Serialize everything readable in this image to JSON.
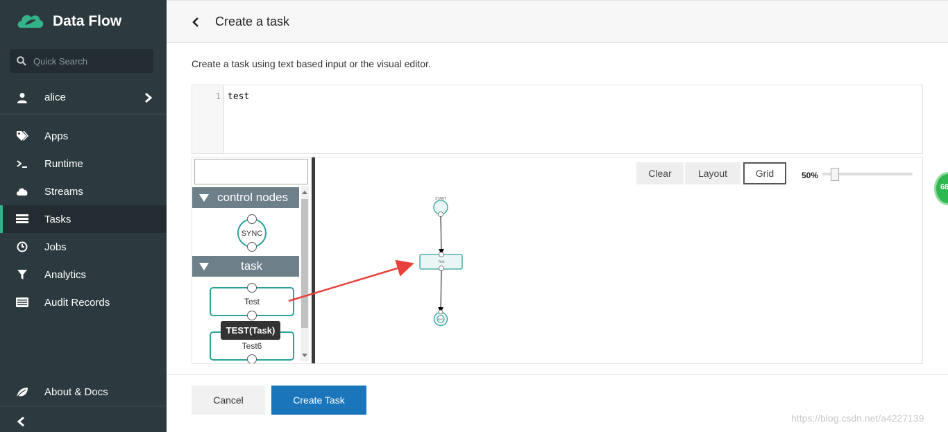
{
  "sidebar": {
    "brand": "Data Flow",
    "search_placeholder": "Quick Search",
    "user": "alice",
    "items": [
      {
        "label": "Apps",
        "icon": "tags-icon"
      },
      {
        "label": "Runtime",
        "icon": "terminal-icon"
      },
      {
        "label": "Streams",
        "icon": "cloud-icon"
      },
      {
        "label": "Tasks",
        "icon": "tasks-icon",
        "active": true
      },
      {
        "label": "Jobs",
        "icon": "clock-icon"
      },
      {
        "label": "Analytics",
        "icon": "filter-icon"
      },
      {
        "label": "Audit Records",
        "icon": "list-icon"
      }
    ],
    "about": "About & Docs"
  },
  "header": {
    "title": "Create a task"
  },
  "subtitle": "Create a task using text based input or the visual editor.",
  "editor": {
    "line_number": "1",
    "code": "test"
  },
  "palette": {
    "groups": [
      "control nodes",
      "task"
    ],
    "sync_label": "SYNC",
    "task_items": [
      "Test",
      "Test6"
    ],
    "tooltip": "TEST(Task)"
  },
  "canvas": {
    "tools": [
      "Clear",
      "Layout",
      "Grid"
    ],
    "zoom": "50%",
    "start_label": "START",
    "task_label": "Test",
    "end_label": "END"
  },
  "actions": {
    "cancel": "Cancel",
    "create": "Create Task"
  },
  "badge": "68",
  "watermark": "https://blog.csdn.net/a4227139",
  "colors": {
    "sidebar": "#2c3a3f",
    "accent": "#34b38a",
    "primary": "#1b75ba",
    "node": "#2aa198",
    "arrow": "#e8413b"
  }
}
